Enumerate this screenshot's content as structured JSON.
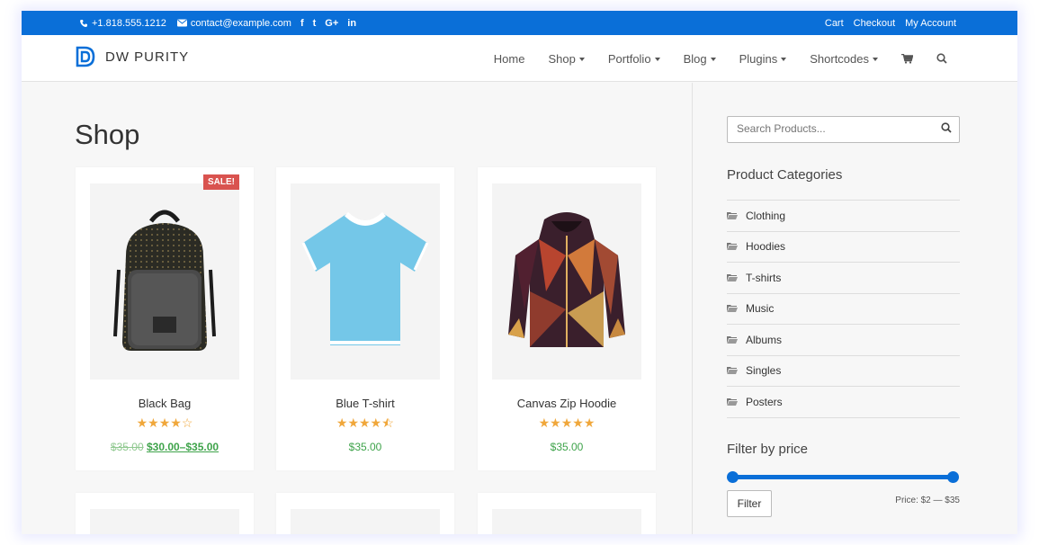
{
  "topbar": {
    "phone": "+1.818.555.1212",
    "email": "contact@example.com",
    "social": [
      "f",
      "t",
      "G+",
      "in"
    ],
    "links": [
      "Cart",
      "Checkout",
      "My Account"
    ]
  },
  "header": {
    "logo_text": "DW PURITY",
    "nav": [
      {
        "label": "Home",
        "dropdown": false
      },
      {
        "label": "Shop",
        "dropdown": true
      },
      {
        "label": "Portfolio",
        "dropdown": true
      },
      {
        "label": "Blog",
        "dropdown": true
      },
      {
        "label": "Plugins",
        "dropdown": true
      },
      {
        "label": "Shortcodes",
        "dropdown": true
      }
    ],
    "icons": [
      "cart-icon",
      "search-icon"
    ]
  },
  "main": {
    "title": "Shop",
    "products": [
      {
        "name": "Black Bag",
        "rating": 4,
        "badge": "SALE!",
        "old_price": "$35.00",
        "price": "$30.00–$35.00"
      },
      {
        "name": "Blue T-shirt",
        "rating": 4.5,
        "price": "$35.00"
      },
      {
        "name": "Canvas Zip Hoodie",
        "rating": 5,
        "price": "$35.00"
      }
    ]
  },
  "sidebar": {
    "search_placeholder": "Search Products...",
    "categories_title": "Product Categories",
    "categories": [
      "Clothing",
      "Hoodies",
      "T-shirts",
      "Music",
      "Albums",
      "Singles",
      "Posters"
    ],
    "filter_title": "Filter by price",
    "filter_button": "Filter",
    "price_range": "Price: $2 — $35"
  },
  "colors": {
    "accent": "#0a6fd8",
    "price": "#3ea34a",
    "star": "#f0a73b",
    "sale": "#d9534f"
  }
}
